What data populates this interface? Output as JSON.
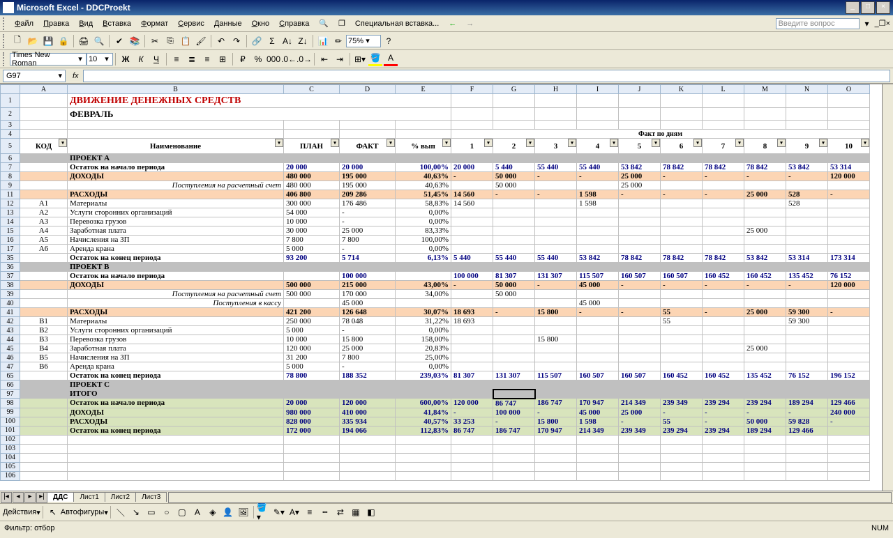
{
  "title": "Microsoft Excel - DDCProekt",
  "menu": [
    "Файл",
    "Правка",
    "Вид",
    "Вставка",
    "Формат",
    "Сервис",
    "Данные",
    "Окно",
    "Справка"
  ],
  "special_paste": "Специальная вставка...",
  "question_placeholder": "Введите вопрос",
  "font_name": "Times New Roman",
  "font_size": "10",
  "zoom": "75%",
  "namebox": "G97",
  "cols": [
    "",
    "A",
    "B",
    "C",
    "D",
    "E",
    "F",
    "G",
    "H",
    "I",
    "J",
    "K",
    "L",
    "M",
    "N",
    "O"
  ],
  "doc_title": "ДВИЖЕНИЕ ДЕНЕЖНЫХ СРЕДСТВ",
  "doc_month": "ФЕВРАЛЬ",
  "fakt_header": "Факт по дням",
  "col_headers": {
    "kod": "КОД",
    "name": "Наименование",
    "plan": "ПЛАН",
    "fakt": "ФАКТ",
    "pct": "% вып"
  },
  "day_nums": [
    "1",
    "2",
    "3",
    "4",
    "5",
    "6",
    "7",
    "8",
    "9",
    "10"
  ],
  "rows": [
    {
      "r": "6",
      "type": "proj",
      "b": "ПРОЕКТ А"
    },
    {
      "r": "7",
      "type": "bold",
      "b": "Остаток на начало периода",
      "c": "20 000",
      "d": "20 000",
      "e": "100,00%",
      "days": [
        "20 000",
        "5 440",
        "55 440",
        "55 440",
        "53 842",
        "78 842",
        "78 842",
        "78 842",
        "53 842",
        "53 314"
      ]
    },
    {
      "r": "8",
      "type": "peach",
      "b": "ДОХОДЫ",
      "c": "480 000",
      "d": "195 000",
      "e": "40,63%",
      "days": [
        "-",
        "50 000",
        "-",
        "-",
        "25 000",
        "-",
        "-",
        "-",
        "-",
        "120 000"
      ]
    },
    {
      "r": "9",
      "type": "italic",
      "b": "Поступления на расчетный счет",
      "c": "480 000",
      "d": "195 000",
      "e": "40,63%",
      "days": [
        "",
        "50 000",
        "",
        "",
        "25 000",
        "",
        "",
        "",
        "",
        ""
      ]
    },
    {
      "r": "11",
      "type": "peach",
      "b": "РАСХОДЫ",
      "c": "406 800",
      "d": "209 286",
      "e": "51,45%",
      "days": [
        "14 560",
        "-",
        "-",
        "1 598",
        "-",
        "-",
        "-",
        "25 000",
        "528",
        "-"
      ]
    },
    {
      "r": "12",
      "a": "А1",
      "b": "Материалы",
      "c": "300 000",
      "d": "176 486",
      "e": "58,83%",
      "days": [
        "14 560",
        "",
        "",
        "1 598",
        "",
        "",
        "",
        "",
        "528",
        ""
      ]
    },
    {
      "r": "13",
      "a": "А2",
      "b": "Услуги сторонних организаций",
      "c": "54 000",
      "d": "-",
      "e": "0,00%"
    },
    {
      "r": "14",
      "a": "А3",
      "b": "Перевозка грузов",
      "c": "10 000",
      "d": "-",
      "e": "0,00%"
    },
    {
      "r": "15",
      "a": "А4",
      "b": "Заработная плата",
      "c": "30 000",
      "d": "25 000",
      "e": "83,33%",
      "days": [
        "",
        "",
        "",
        "",
        "",
        "",
        "",
        "25 000",
        "",
        ""
      ]
    },
    {
      "r": "16",
      "a": "А5",
      "b": "Начисления на ЗП",
      "c": "7 800",
      "d": "7 800",
      "e": "100,00%"
    },
    {
      "r": "17",
      "a": "А6",
      "b": "Аренда крана",
      "c": "5 000",
      "d": "-",
      "e": "0,00%"
    },
    {
      "r": "35",
      "type": "bold",
      "b": "Остаток на конец периода",
      "c": "93 200",
      "d": "5 714",
      "e": "6,13%",
      "days": [
        "5 440",
        "55 440",
        "55 440",
        "53 842",
        "78 842",
        "78 842",
        "78 842",
        "53 842",
        "53 314",
        "173 314"
      ]
    },
    {
      "r": "36",
      "type": "proj",
      "b": "ПРОЕКТ В"
    },
    {
      "r": "37",
      "type": "bold",
      "b": "Остаток на начало периода",
      "c": "",
      "d": "100 000",
      "e": "",
      "days": [
        "100 000",
        "81 307",
        "131 307",
        "115 507",
        "160 507",
        "160 507",
        "160 452",
        "160 452",
        "135 452",
        "76 152"
      ]
    },
    {
      "r": "38",
      "type": "peach",
      "b": "ДОХОДЫ",
      "c": "500 000",
      "d": "215 000",
      "e": "43,00%",
      "days": [
        "-",
        "50 000",
        "-",
        "45 000",
        "-",
        "-",
        "-",
        "-",
        "-",
        "120 000"
      ]
    },
    {
      "r": "39",
      "type": "italic",
      "b": "Поступления на расчетный счет",
      "c": "500 000",
      "d": "170 000",
      "e": "34,00%",
      "days": [
        "",
        "50 000",
        "",
        "",
        "",
        "",
        "",
        "",
        "",
        ""
      ]
    },
    {
      "r": "40",
      "type": "italic",
      "b": "Поступления в кассу",
      "c": "",
      "d": "45 000",
      "e": "",
      "days": [
        "",
        "",
        "",
        "45 000",
        "",
        "",
        "",
        "",
        "",
        ""
      ]
    },
    {
      "r": "41",
      "type": "peach",
      "b": "РАСХОДЫ",
      "c": "421 200",
      "d": "126 648",
      "e": "30,07%",
      "days": [
        "18 693",
        "-",
        "15 800",
        "-",
        "-",
        "55",
        "-",
        "25 000",
        "59 300",
        "-"
      ]
    },
    {
      "r": "42",
      "a": "В1",
      "b": "Материалы",
      "c": "250 000",
      "d": "78 048",
      "e": "31,22%",
      "days": [
        "18 693",
        "",
        "",
        "",
        "",
        "55",
        "",
        "",
        "59 300",
        ""
      ]
    },
    {
      "r": "43",
      "a": "В2",
      "b": "Услуги сторонних организаций",
      "c": "5 000",
      "d": "-",
      "e": "0,00%"
    },
    {
      "r": "44",
      "a": "В3",
      "b": "Перевозка грузов",
      "c": "10 000",
      "d": "15 800",
      "e": "158,00%",
      "days": [
        "",
        "",
        "15 800",
        "",
        "",
        "",
        "",
        "",
        "",
        ""
      ]
    },
    {
      "r": "45",
      "a": "В4",
      "b": "Заработная плата",
      "c": "120 000",
      "d": "25 000",
      "e": "20,83%",
      "days": [
        "",
        "",
        "",
        "",
        "",
        "",
        "",
        "25 000",
        "",
        ""
      ]
    },
    {
      "r": "46",
      "a": "В5",
      "b": "Начисления на ЗП",
      "c": "31 200",
      "d": "7 800",
      "e": "25,00%"
    },
    {
      "r": "47",
      "a": "В6",
      "b": "Аренда крана",
      "c": "5 000",
      "d": "-",
      "e": "0,00%"
    },
    {
      "r": "65",
      "type": "bold",
      "b": "Остаток на конец периода",
      "c": "78 800",
      "d": "188 352",
      "e": "239,03%",
      "days": [
        "81 307",
        "131 307",
        "115 507",
        "160 507",
        "160 507",
        "160 452",
        "160 452",
        "135 452",
        "76 152",
        "196 152"
      ]
    },
    {
      "r": "66",
      "type": "proj",
      "b": "ПРОЕКТ С"
    },
    {
      "r": "97",
      "type": "proj",
      "b": "ИТОГО",
      "sel": true
    },
    {
      "r": "98",
      "type": "green",
      "b": "Остаток на начало периода",
      "c": "20 000",
      "d": "120 000",
      "e": "600,00%",
      "days": [
        "120 000",
        "86 747",
        "186 747",
        "170 947",
        "214 349",
        "239 349",
        "239 294",
        "239 294",
        "189 294",
        "129 466"
      ]
    },
    {
      "r": "99",
      "type": "green",
      "b": "ДОХОДЫ",
      "c": "980 000",
      "d": "410 000",
      "e": "41,84%",
      "days": [
        "-",
        "100 000",
        "-",
        "45 000",
        "25 000",
        "-",
        "-",
        "-",
        "-",
        "240 000"
      ]
    },
    {
      "r": "100",
      "type": "green",
      "b": "РАСХОДЫ",
      "c": "828 000",
      "d": "335 934",
      "e": "40,57%",
      "days": [
        "33 253",
        "-",
        "15 800",
        "1 598",
        "-",
        "55",
        "-",
        "50 000",
        "59 828",
        "-"
      ]
    },
    {
      "r": "101",
      "type": "green",
      "b": "Остаток на конец периода",
      "c": "172 000",
      "d": "194 066",
      "e": "112,83%",
      "days": [
        "86 747",
        "186 747",
        "170 947",
        "214 349",
        "239 349",
        "239 294",
        "239 294",
        "189 294",
        "129 466",
        ""
      ]
    },
    {
      "r": "102"
    },
    {
      "r": "103"
    },
    {
      "r": "104"
    },
    {
      "r": "105"
    },
    {
      "r": "106"
    }
  ],
  "tabs": [
    "ДДС",
    "Лист1",
    "Лист2",
    "Лист3"
  ],
  "actions_label": "Действия",
  "autoshapes_label": "Автофигуры",
  "status_filter": "Фильтр: отбор",
  "status_num": "NUM"
}
